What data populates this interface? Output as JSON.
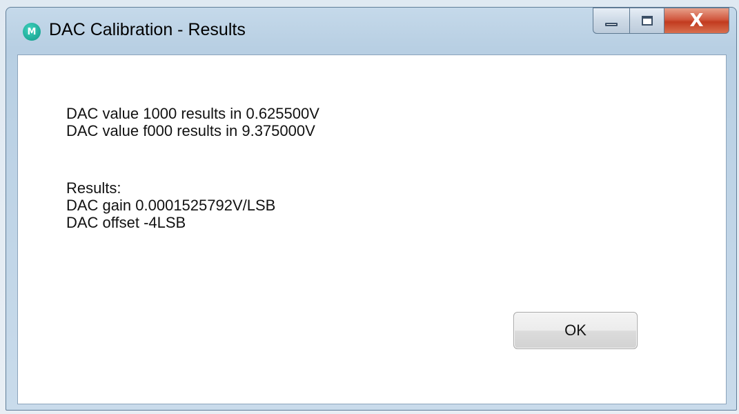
{
  "window": {
    "title": "DAC Calibration - Results",
    "app_icon_glyph": "M",
    "controls": {
      "minimize_icon": "minimize-icon",
      "maximize_icon": "maximize-icon",
      "close_icon": "close-icon",
      "close_glyph": "X",
      "close_color": "#c9452a"
    }
  },
  "content": {
    "measurements": [
      "DAC value 1000 results in 0.625500V",
      "DAC value f000 results in 9.375000V"
    ],
    "results_heading": "Results:",
    "results": [
      "DAC gain 0.0001525792V/LSB",
      "DAC offset -4LSB"
    ]
  },
  "buttons": {
    "ok_label": "OK"
  }
}
